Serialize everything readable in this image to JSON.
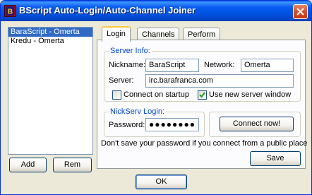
{
  "window": {
    "title": "BScript Auto-Login/Auto-Channel Joiner"
  },
  "profiles": {
    "items": [
      {
        "label": "BaraScript - Omerta",
        "selected": true
      },
      {
        "label": "Kredu - Omerta",
        "selected": false
      }
    ],
    "add_label": "Add",
    "remove_label": "Rem"
  },
  "tabs": [
    {
      "label": "Login",
      "active": true
    },
    {
      "label": "Channels",
      "active": false
    },
    {
      "label": "Perform",
      "active": false
    }
  ],
  "server_info": {
    "legend": "Server Info:",
    "nickname_label": "Nickname:",
    "nickname_value": "BaraScript",
    "network_label": "Network:",
    "network_value": "Omerta",
    "server_label": "Server:",
    "server_value": "irc.barafranca.com",
    "connect_startup_label": "Connect on startup",
    "connect_startup_checked": false,
    "new_window_label": "Use new server window",
    "new_window_checked": true
  },
  "nickserv": {
    "legend": "NickServ Login:",
    "password_label": "Password:",
    "password_mask": "●●●●●●●●"
  },
  "connect_now_label": "Connect now!",
  "warning_text": "Don't save your password if you connect from a public place",
  "save_label": "Save",
  "ok_label": "OK"
}
